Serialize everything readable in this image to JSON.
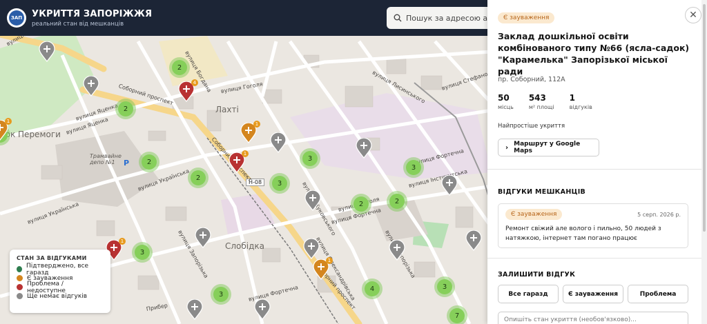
{
  "header": {
    "logo_text": "ЗАП",
    "title": "УКРИТТЯ ЗАПОРІЖЖЯ",
    "subtitle": "реальний стан від мешканців",
    "search_placeholder": "Пошук за адресою або н"
  },
  "map": {
    "labels": {
      "lakhty": "Лахті",
      "slobidka": "Слобідка",
      "park": "арк Перемоги",
      "depot": "Трамвайне депо №1",
      "h08": "Н-08",
      "p": "P"
    },
    "roads": {
      "soborny1": "Соборний проспект",
      "soborny2": "Соборний проспект",
      "soborny3": "Соборний проспект",
      "yatsenka": "вулиця Яценка",
      "yatsenka2": "вулиця Яценка",
      "yatsenka3": "вулиця Яценка",
      "ukrainska": "вулиця Українська",
      "ukrainska2": "вулиця Українська",
      "gogolya": "вулиця Гоголя",
      "gogolya2": "вулиця Гоголя",
      "forteczna": "вулиця Фортечна",
      "forteczna2": "вулиця Фортечна",
      "forteczna3": "вулиця Фортечна",
      "instytutska": "вулиця Інститутська",
      "zaporizka": "вулиця Запорізька",
      "zaporizka2": "вулиця Запорізька",
      "stefanova": "вулиця Стефанова",
      "bohdana": "вулиця Богдана",
      "zhukovskoho": "вулиця Жуковського",
      "oleksandrivska": "вулиця Олександрівська",
      "lisnyi": "вулиця Лисинського",
      "prybeh": "Прибер"
    },
    "clusters": [
      "2",
      "2",
      "2",
      "2",
      "3",
      "3",
      "3",
      "2",
      "2",
      "3",
      "3",
      "4",
      "3",
      "3",
      "7"
    ],
    "pin_badges": [
      "4",
      "1",
      "1",
      "1",
      "1",
      "1"
    ]
  },
  "legend": {
    "title": "СТАН ЗА ВІДГУКАМИ",
    "items": [
      {
        "label": "Підтверджено, все гаразд",
        "color": "#2e7d4f"
      },
      {
        "label": "Є зауваження",
        "color": "#d4861f"
      },
      {
        "label": "Проблема / недоступне",
        "color": "#b83232"
      },
      {
        "label": "Ще немає відгуків",
        "color": "#8a8a8a"
      }
    ]
  },
  "panel": {
    "status_pill": "Є зауваження",
    "title": "Заклад дошкільної освіти комбінованого типу №66 (ясла-садок) \"Карамелька\" Запорізької міської ради",
    "address": "пр. Соборний, 112А",
    "stats": [
      {
        "value": "50",
        "label": "місць"
      },
      {
        "value": "543",
        "label": "м² площі"
      },
      {
        "value": "1",
        "label": "відгуків"
      }
    ],
    "type": "Найпростіше укриття",
    "route_button": "Маршрут у Google Maps",
    "reviews_title": "ВІДГУКИ МЕШКАНЦІВ",
    "review": {
      "pill": "Є зауваження",
      "date": "5 серп. 2026 р.",
      "text": "Ремонт свіжий але волого і пильно, 50 людей з натяжкою, інтернет там погано працює"
    },
    "leave_title": "ЗАЛИШИТИ ВІДГУК",
    "options": [
      "Все гаразд",
      "Є зауваження",
      "Проблема"
    ],
    "comment_placeholder": "Опишіть стан укриття (необов'язково)..."
  },
  "colors": {
    "header_bg": "#1c2536",
    "cluster": "#86cf5a",
    "pin_grey": "#8a8a8a",
    "pin_red": "#b83232",
    "pin_orange": "#d4861f",
    "badge": "#e79a1d"
  }
}
